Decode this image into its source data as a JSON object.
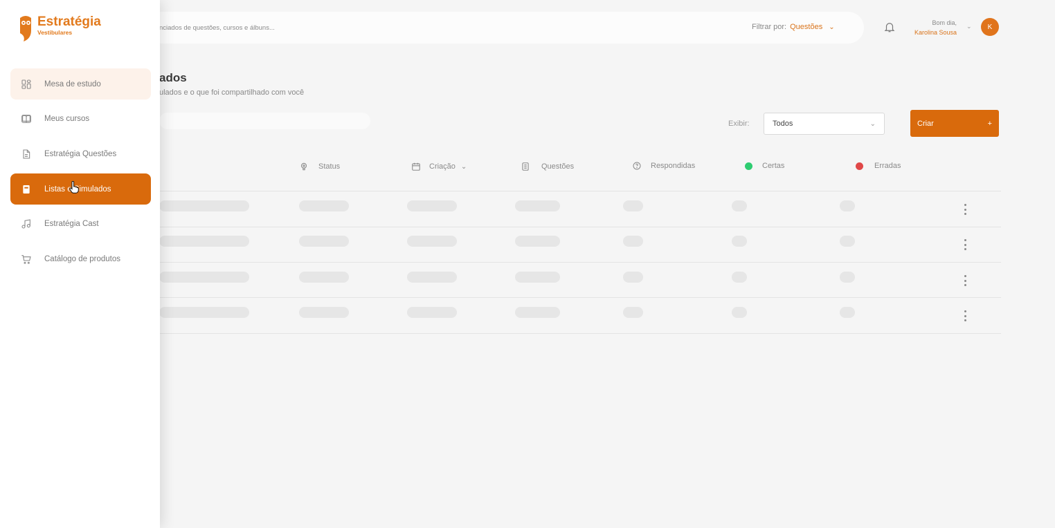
{
  "brand": {
    "name": "Estratégia",
    "subtitle": "Vestibulares",
    "color": "#e27a1d"
  },
  "topbar": {
    "search_placeholder": "nciados de questões, cursos e álbuns...",
    "filter_label": "Filtrar por:",
    "filter_value": "Questões",
    "greeting": "Bom dia,",
    "user_name": "Karolina Sousa",
    "avatar_initial": "K"
  },
  "page": {
    "title": "ados",
    "subtitle": "ulados e o que foi compartilhado com você"
  },
  "toolbar": {
    "exibir_label": "Exibir:",
    "exibir_value": "Todos",
    "create_label": "Criar",
    "create_icon": "+"
  },
  "table": {
    "headers": [
      {
        "label": "Status",
        "icon": "lightbulb-icon"
      },
      {
        "label": "Criação",
        "icon": "calendar-icon"
      },
      {
        "label": "Questões",
        "icon": "document-icon"
      },
      {
        "label": "Respondidas",
        "icon": "question-icon"
      },
      {
        "label": "Certas",
        "icon": "green-dot"
      },
      {
        "label": "Erradas",
        "icon": "red-dot"
      }
    ],
    "row_count": 4
  },
  "sidebar": {
    "items": [
      {
        "label": "Mesa de estudo",
        "icon": "grid-icon",
        "state": "hover"
      },
      {
        "label": "Meus cursos",
        "icon": "book-open-icon",
        "state": "normal"
      },
      {
        "label": "Estratégia Questões",
        "icon": "file-icon",
        "state": "normal"
      },
      {
        "label": "Listas e Simulados",
        "icon": "notebook-icon",
        "state": "active"
      },
      {
        "label": "Estratégia Cast",
        "icon": "music-icon",
        "state": "normal"
      },
      {
        "label": "Catálogo de produtos",
        "icon": "cart-icon",
        "state": "normal"
      }
    ]
  },
  "colors": {
    "accent": "#d96a0c",
    "certas": "#2ecc71",
    "erradas": "#e04848"
  }
}
